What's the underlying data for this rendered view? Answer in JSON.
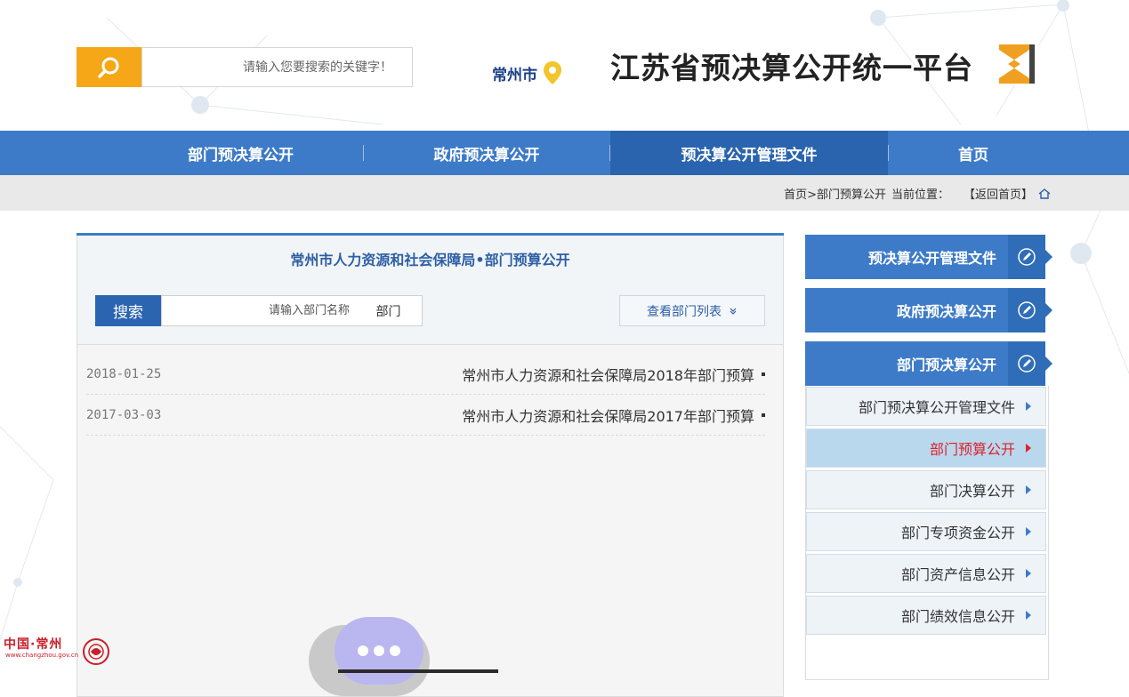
{
  "header": {
    "site_title": "江苏省预决算公开统一平台",
    "city": "常州市",
    "search_placeholder": "请输入您要搜索的关键字！"
  },
  "nav": {
    "items": [
      {
        "label": "部门预决算公开"
      },
      {
        "label": "政府预决算公开"
      },
      {
        "label": "预决算公开管理文件",
        "active": true
      },
      {
        "label": "首页"
      }
    ]
  },
  "breadcrumb": {
    "back_home": "【返回首页】",
    "current_label": "当前位置：",
    "path": "首页>部门预算公开"
  },
  "main": {
    "title": "常州市人力资源和社会保障局•部门预算公开",
    "view_list_label": "查看部门列表",
    "dept_label": "部门",
    "dept_placeholder": "请输入部门名称",
    "search_label": "搜索",
    "items": [
      {
        "title": "常州市人力资源和社会保障局2018年部门预算",
        "date": "2018-01-25"
      },
      {
        "title": "常州市人力资源和社会保障局2017年部门预算",
        "date": "2017-03-03"
      }
    ]
  },
  "sidebar": {
    "headers": [
      {
        "label": "预决算公开管理文件"
      },
      {
        "label": "政府预决算公开"
      },
      {
        "label": "部门预决算公开"
      }
    ],
    "items": [
      {
        "label": "部门预决算公开管理文件"
      },
      {
        "label": "部门预算公开",
        "active": true
      },
      {
        "label": "部门决算公开"
      },
      {
        "label": "部门专项资金公开"
      },
      {
        "label": "部门资产信息公开"
      },
      {
        "label": "部门绩效信息公开"
      }
    ]
  },
  "footer_logo": {
    "text": "中国·常州",
    "url": "www.changzhou.gov.cn"
  },
  "colors": {
    "nav_blue": "#3d7bc8",
    "accent_orange": "#f5a717",
    "active_red": "#e0202a"
  }
}
